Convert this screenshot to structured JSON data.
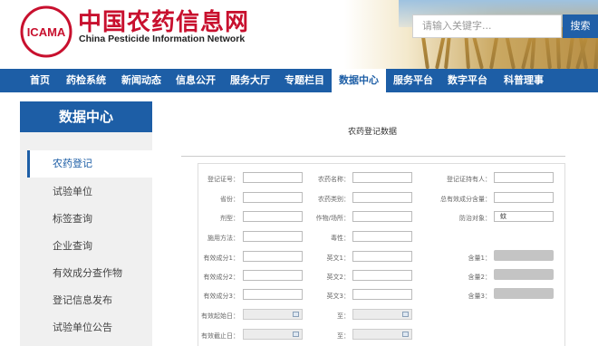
{
  "header": {
    "site_title": "中国农药信息网",
    "site_subtitle": "China Pesticide Information Network",
    "logo_text": "ICAMA",
    "search_placeholder": "请输入关键字...",
    "search_button": "搜索"
  },
  "nav": {
    "items": [
      {
        "label": "首页"
      },
      {
        "label": "药检系统"
      },
      {
        "label": "新闻动态"
      },
      {
        "label": "信息公开"
      },
      {
        "label": "服务大厅"
      },
      {
        "label": "专题栏目"
      },
      {
        "label": "数据中心"
      },
      {
        "label": "服务平台"
      },
      {
        "label": "数字平台"
      },
      {
        "label": "科普理事"
      }
    ],
    "active": "数据中心"
  },
  "sidebar": {
    "title": "数据中心",
    "items": [
      {
        "label": "农药登记"
      },
      {
        "label": "试验单位"
      },
      {
        "label": "标签查询"
      },
      {
        "label": "企业查询"
      },
      {
        "label": "有效成分查作物"
      },
      {
        "label": "登记信息发布"
      },
      {
        "label": "试验单位公告"
      }
    ],
    "active": "农药登记"
  },
  "main": {
    "title": "农药登记数据",
    "fields": {
      "reg_no": {
        "label": "登记证号：",
        "value": ""
      },
      "pesticide_name": {
        "label": "农药名称：",
        "value": ""
      },
      "reg_holder": {
        "label": "登记证持有人：",
        "value": ""
      },
      "province": {
        "label": "省份：",
        "value": ""
      },
      "category": {
        "label": "农药类别：",
        "value": ""
      },
      "total_content": {
        "label": "总有效成分含量：",
        "value": ""
      },
      "formulation": {
        "label": "剂型：",
        "value": ""
      },
      "crop": {
        "label": "作物/场所：",
        "value": ""
      },
      "target": {
        "label": "防治对象：",
        "value": "蚊"
      },
      "method": {
        "label": "施用方法：",
        "value": ""
      },
      "toxicity": {
        "label": "毒性：",
        "value": ""
      },
      "ingredient1": {
        "label": "有效成分1：",
        "value": ""
      },
      "english1": {
        "label": "英文1：",
        "value": ""
      },
      "content1": {
        "label": "含量1：",
        "value": ""
      },
      "ingredient2": {
        "label": "有效成分2：",
        "value": ""
      },
      "english2": {
        "label": "英文2：",
        "value": ""
      },
      "content2": {
        "label": "含量2：",
        "value": ""
      },
      "ingredient3": {
        "label": "有效成分3：",
        "value": ""
      },
      "english3": {
        "label": "英文3：",
        "value": ""
      },
      "content3": {
        "label": "含量3：",
        "value": ""
      },
      "valid_start": {
        "label": "有效起始日：",
        "value": ""
      },
      "valid_start_to": {
        "label": "至：",
        "value": ""
      },
      "valid_end": {
        "label": "有效截止日：",
        "value": ""
      },
      "valid_end_to": {
        "label": "至：",
        "value": ""
      }
    }
  },
  "colors": {
    "brand_red": "#c8102e",
    "nav_blue": "#1d5ea6"
  }
}
